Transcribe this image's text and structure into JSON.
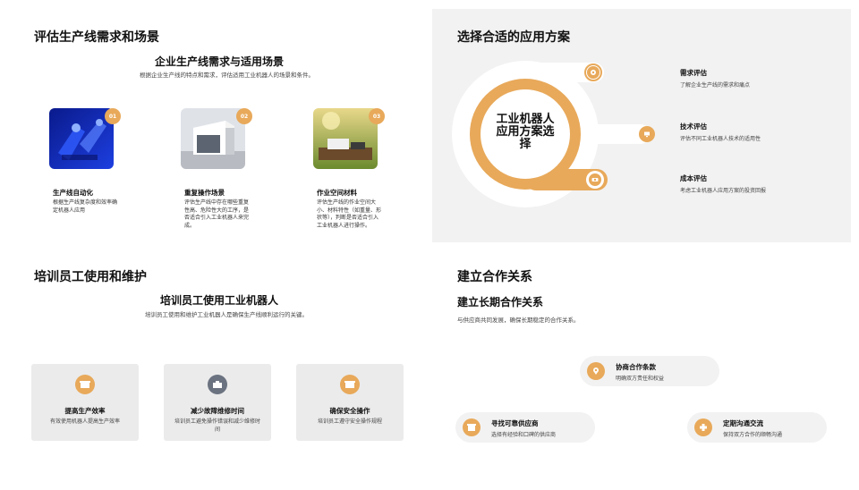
{
  "panel1": {
    "title": "评估生产线需求和场景",
    "subtitle": "企业生产线需求与适用场景",
    "desc": "根据企业生产线的特点和需求，评估适用工业机器人的场景和条件。",
    "cards": [
      {
        "num": "01",
        "title": "生产线自动化",
        "text": "根据生产线复杂度和效率确定机器人应用",
        "icon": "blue-robot-image"
      },
      {
        "num": "02",
        "title": "重复操作场景",
        "text": "评估生产线中存在哪些重复性高、危险性大的工序，是否适合引入工业机器人来完成。",
        "icon": "building-image"
      },
      {
        "num": "03",
        "title": "作业空间材料",
        "text": "评估生产线的作业空间大小、材料特性（如重量、形状等），判断是否适合引入工业机器人进行操作。",
        "icon": "workspace-image"
      }
    ]
  },
  "panel2": {
    "title": "选择合适的应用方案",
    "center_label": "工业机器人应用方案选择",
    "items": [
      {
        "title": "需求评估",
        "desc": "了解企业生产线的需求和痛点",
        "icon": "gear-icon"
      },
      {
        "title": "技术评估",
        "desc": "评估不同工业机器人技术的适用性",
        "icon": "screen-icon"
      },
      {
        "title": "成本评估",
        "desc": "考虑工业机器人应用方案的投资回报",
        "icon": "money-icon"
      }
    ]
  },
  "panel3": {
    "title": "培训员工使用和维护",
    "subtitle": "培训员工使用工业机器人",
    "desc": "培训员工使用和维护工业机器人是确保生产线顺利运行的关键。",
    "boxes": [
      {
        "title": "提高生产效率",
        "desc": "有效使用机器人提高生产效率",
        "icon": "box-icon",
        "color": "#e8a95a"
      },
      {
        "title": "减少故障维修时间",
        "desc": "培训员工避免操作错误和减少维修时间",
        "icon": "tool-icon",
        "color": "#6b7280"
      },
      {
        "title": "确保安全操作",
        "desc": "培训员工遵守安全操作规程",
        "icon": "shield-icon",
        "color": "#e8a95a"
      }
    ]
  },
  "panel4": {
    "title": "建立合作关系",
    "subtitle": "建立长期合作关系",
    "desc": "与供应商共同发展，确保长期稳定的合作关系。",
    "pills": [
      {
        "title": "协商合作条款",
        "desc": "明确双方责任和权益",
        "icon": "pin-icon"
      },
      {
        "title": "寻找可靠供应商",
        "desc": "选择有经验和口碑的供应商",
        "icon": "store-icon"
      },
      {
        "title": "定期沟通交流",
        "desc": "保持双方合作的顺畅沟通",
        "icon": "plus-icon"
      }
    ]
  }
}
